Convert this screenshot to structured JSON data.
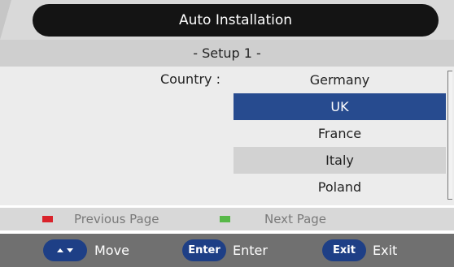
{
  "header": {
    "title": "Auto Installation"
  },
  "setup": {
    "subtitle": "- Setup 1 -"
  },
  "form": {
    "country_label": "Country :",
    "countries": [
      "Germany",
      "UK",
      "France",
      "Italy",
      "Poland"
    ],
    "selected": "UK"
  },
  "hints": {
    "previous_page": "Previous Page",
    "next_page": "Next Page",
    "red_color": "#d9232b",
    "green_color": "#57b848"
  },
  "nav": {
    "move_label": "Move",
    "enter_key": "Enter",
    "enter_label": "Enter",
    "exit_key": "Exit",
    "exit_label": "Exit"
  }
}
